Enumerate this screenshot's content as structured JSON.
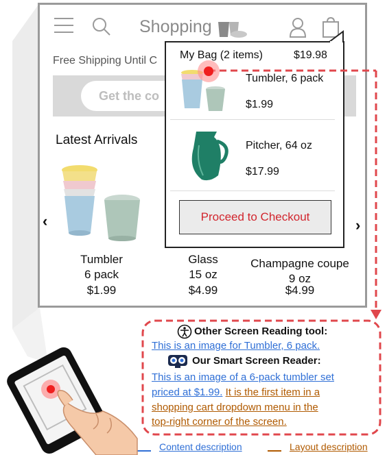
{
  "app_header": {
    "title": "Shopping"
  },
  "banner": {
    "free_shipping": "Free Shipping Until C",
    "cta_label": "Get the co"
  },
  "section": {
    "title": "Latest Arrivals"
  },
  "carousel": {
    "prev_arrow": "‹",
    "next_arrow": "›",
    "products": [
      {
        "name_line1": "Tumbler",
        "name_line2": "6 pack",
        "price": "$1.99"
      },
      {
        "name_line1": "Glass",
        "name_line2": "15 oz",
        "price": "$4.99"
      },
      {
        "name_line1": "Champagne coupe",
        "name_line2": "9 oz",
        "price": "$4.99"
      }
    ]
  },
  "bag_dropdown": {
    "title": "My Bag (2 items)",
    "total": "$19.98",
    "items": [
      {
        "name": "Tumbler, 6 pack",
        "price": "$1.99"
      },
      {
        "name": "Pitcher, 64 oz",
        "price": "$17.99"
      }
    ],
    "checkout_label": "Proceed to Checkout"
  },
  "reader_comparison": {
    "other_title": "Other Screen Reading tool:",
    "other_text": "This is an image for Tumbler, 6 pack.",
    "smart_title": "Our Smart Screen Reader:",
    "smart_content_1": "This is an image of a 6-pack tumbler set",
    "smart_content_2": "priced at $1.99.",
    "smart_layout_1": "It is the first item in a",
    "smart_layout_2": "shopping cart dropdown menu in the",
    "smart_layout_3": "top-right corner of the screen."
  },
  "legend": {
    "content": "Content description",
    "layout": "Layout description"
  },
  "colors": {
    "content": "#2f6fd6",
    "layout": "#b05a00",
    "dashed": "#e0474c",
    "accent": "#d2262e"
  }
}
